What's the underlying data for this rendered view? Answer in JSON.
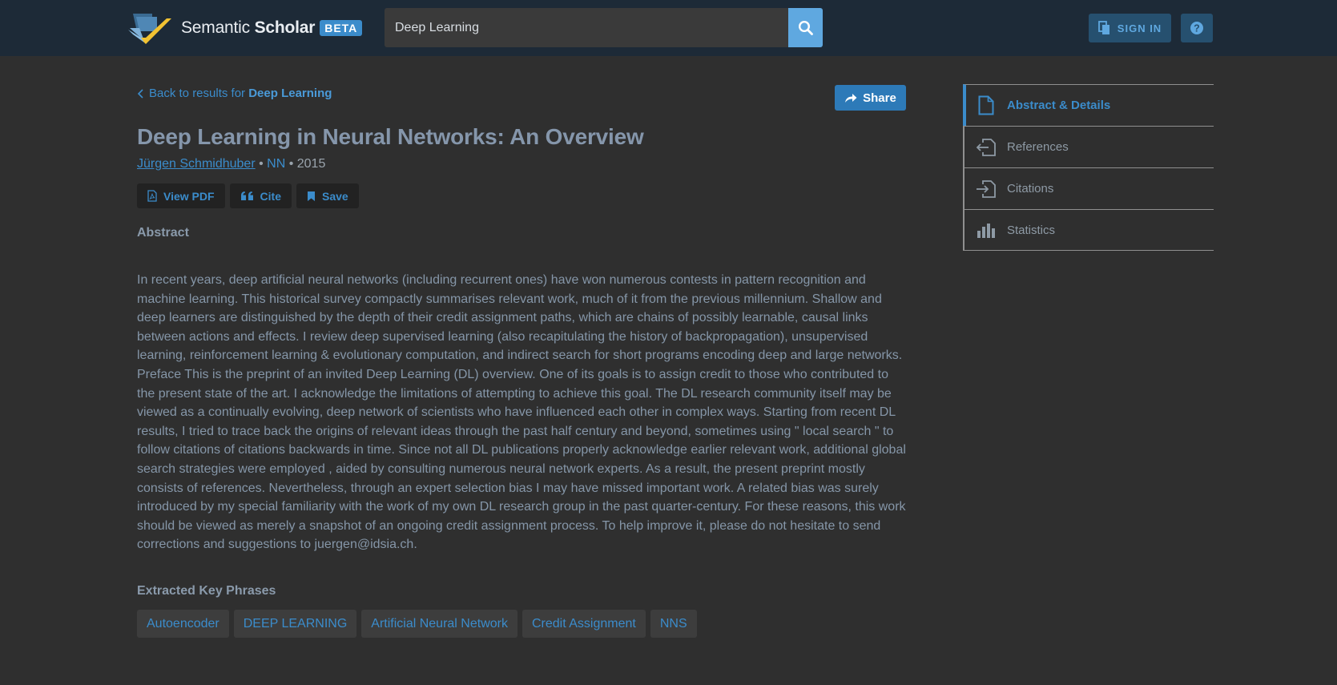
{
  "header": {
    "logo_light": "Semantic ",
    "logo_bold": "Scholar",
    "beta_label": "BETA",
    "search_value": "Deep Learning",
    "signin_label": "SIGN IN",
    "help_label": "?"
  },
  "paper": {
    "back_prefix": "Back to results for ",
    "back_query": "Deep Learning",
    "share_label": "Share",
    "title": "Deep Learning in Neural Networks: An Overview",
    "author": "Jürgen Schmidhuber",
    "sep1": " • ",
    "venue": "NN",
    "sep2": " • ",
    "year": "2015",
    "actions": {
      "pdf": "View PDF",
      "cite": "Cite",
      "save": "Save"
    },
    "abstract_heading": "Abstract",
    "abstract": "In recent years, deep artificial neural networks (including recurrent ones) have won numerous contests in pattern recognition and machine learning. This historical survey compactly summarises relevant work, much of it from the previous millennium. Shallow and deep learners are distinguished by the depth of their credit assignment paths, which are chains of possibly learnable, causal links between actions and effects. I review deep supervised learning (also recapitulating the history of backpropagation), unsupervised learning, reinforcement learning & evolutionary computation, and indirect search for short programs encoding deep and large networks. Preface This is the preprint of an invited Deep Learning (DL) overview. One of its goals is to assign credit to those who contributed to the present state of the art. I acknowledge the limitations of attempting to achieve this goal. The DL research community itself may be viewed as a continually evolving, deep network of scientists who have influenced each other in complex ways. Starting from recent DL results, I tried to trace back the origins of relevant ideas through the past half century and beyond, sometimes using \" local search \" to follow citations of citations backwards in time. Since not all DL publications properly acknowledge earlier relevant work, additional global search strategies were employed , aided by consulting numerous neural network experts. As a result, the present preprint mostly consists of references. Nevertheless, through an expert selection bias I may have missed important work. A related bias was surely introduced by my special familiarity with the work of my own DL research group in the past quarter-century. For these reasons, this work should be viewed as merely a snapshot of an ongoing credit assignment process. To help improve it, please do not hesitate to send corrections and suggestions to juergen@idsia.ch.",
    "phrases_heading": "Extracted Key Phrases",
    "phrases": [
      "Autoencoder",
      "DEEP LEARNING",
      "Artificial Neural Network",
      "Credit Assignment",
      "NNS"
    ]
  },
  "side_nav": {
    "items": [
      {
        "label": "Abstract & Details",
        "icon": "document-icon"
      },
      {
        "label": "References",
        "icon": "references-icon"
      },
      {
        "label": "Citations",
        "icon": "citations-icon"
      },
      {
        "label": "Statistics",
        "icon": "statistics-icon"
      }
    ]
  },
  "colors": {
    "header_bg": "#1d2a37",
    "page_bg": "#2f2f2f",
    "accent": "#3b8ccb",
    "search_button": "#5fa8e0",
    "logo_chevron": "#f1c232"
  }
}
